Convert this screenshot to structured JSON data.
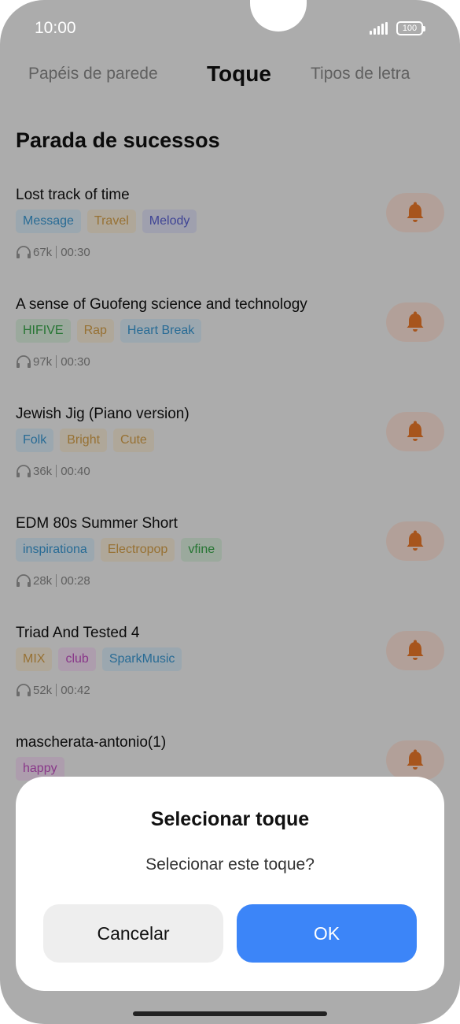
{
  "status_bar": {
    "time": "10:00",
    "battery": "100"
  },
  "tabs": [
    {
      "label": "Papéis de parede",
      "active": false
    },
    {
      "label": "Toque",
      "active": true
    },
    {
      "label": "Tipos de letra",
      "active": false
    }
  ],
  "section_title": "Parada de sucessos",
  "ringtones": [
    {
      "title": "Lost track of time",
      "tags": [
        {
          "label": "Message",
          "color": "#3a9ad6",
          "bg": "#dff0fb"
        },
        {
          "label": "Travel",
          "color": "#d9a24a",
          "bg": "#fbf0dc"
        },
        {
          "label": "Melody",
          "color": "#5b62d6",
          "bg": "#e4e5fa"
        }
      ],
      "plays": "67k",
      "duration": "00:30"
    },
    {
      "title": "A sense of Guofeng science and technology",
      "tags": [
        {
          "label": "HIFIVE",
          "color": "#37a84a",
          "bg": "#dff3e1"
        },
        {
          "label": "Rap",
          "color": "#d9a24a",
          "bg": "#fbf0dc"
        },
        {
          "label": "Heart Break",
          "color": "#3a9ad6",
          "bg": "#dff0fb"
        }
      ],
      "plays": "97k",
      "duration": "00:30"
    },
    {
      "title": "Jewish Jig (Piano version)",
      "tags": [
        {
          "label": "Folk",
          "color": "#3a9ad6",
          "bg": "#dff0fb"
        },
        {
          "label": "Bright",
          "color": "#d9a24a",
          "bg": "#fbf0dc"
        },
        {
          "label": "Cute",
          "color": "#d9a24a",
          "bg": "#fbf0dc"
        }
      ],
      "plays": "36k",
      "duration": "00:40"
    },
    {
      "title": "EDM 80s Summer Short",
      "tags": [
        {
          "label": "inspirationa",
          "color": "#3a9ad6",
          "bg": "#dff0fb"
        },
        {
          "label": "Electropop",
          "color": "#d9a24a",
          "bg": "#fbf0dc"
        },
        {
          "label": "vfine",
          "color": "#37a84a",
          "bg": "#dff3e1"
        }
      ],
      "plays": "28k",
      "duration": "00:28"
    },
    {
      "title": "Triad And Tested 4",
      "tags": [
        {
          "label": "MIX",
          "color": "#d9a24a",
          "bg": "#fbf0dc"
        },
        {
          "label": "club",
          "color": "#c44fc4",
          "bg": "#f8e1f8"
        },
        {
          "label": "SparkMusic",
          "color": "#3a9ad6",
          "bg": "#dff0fb"
        }
      ],
      "plays": "52k",
      "duration": "00:42"
    },
    {
      "title": "mascherata-antonio(1)",
      "tags": [
        {
          "label": "happy",
          "color": "#c44fc4",
          "bg": "#f8e1f8"
        }
      ],
      "plays": "",
      "duration": ""
    }
  ],
  "dialog": {
    "title": "Selecionar toque",
    "message": "Selecionar este toque?",
    "cancel_label": "Cancelar",
    "ok_label": "OK"
  },
  "colors": {
    "accent": "#3c85f8",
    "bell": "#f07a2a",
    "bell_bg": "#ffe6dc"
  },
  "icons": {
    "bell": "bell-icon",
    "headphones": "headphones-icon",
    "signal": "signal-icon",
    "battery": "battery-icon"
  }
}
